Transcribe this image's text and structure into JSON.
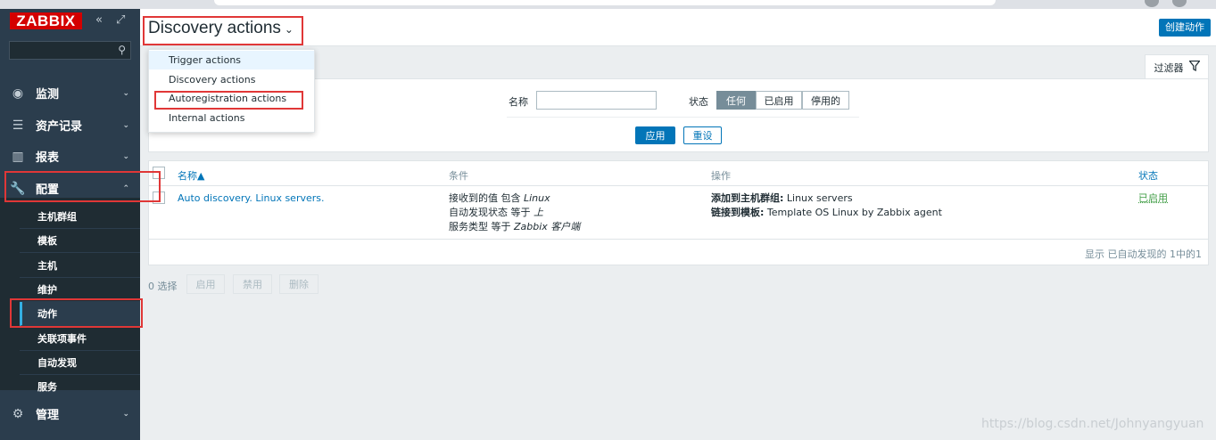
{
  "sidebar": {
    "logo": "ZABBIX",
    "collapse_icon": "double-chevron-left-icon",
    "kiosk_icon": "kiosk-icon",
    "search_icon": "search-icon",
    "nav": [
      {
        "label": "监测",
        "icon": "eye-icon"
      },
      {
        "label": "资产记录",
        "icon": "list-icon"
      },
      {
        "label": "报表",
        "icon": "bar-chart-icon"
      },
      {
        "label": "配置",
        "icon": "wrench-icon"
      },
      {
        "label": "管理",
        "icon": "gear-icon"
      }
    ],
    "submenu": [
      "主机群组",
      "模板",
      "主机",
      "维护",
      "动作",
      "关联项事件",
      "自动发现",
      "服务"
    ],
    "active_submenu": "动作"
  },
  "header": {
    "title": "Discovery actions",
    "create_button": "创建动作"
  },
  "dropdown": {
    "items": [
      "Trigger actions",
      "Discovery actions",
      "Autoregistration actions",
      "Internal actions"
    ],
    "hovered": "Trigger actions"
  },
  "filter": {
    "tab_label": "过滤器",
    "name_label": "名称",
    "name_value": "",
    "status_label": "状态",
    "status_options": [
      "任何",
      "已启用",
      "停用的"
    ],
    "status_selected": "任何",
    "apply": "应用",
    "reset": "重设"
  },
  "table": {
    "columns": {
      "name": "名称▲",
      "conditions": "条件",
      "operations": "操作",
      "status": "状态"
    },
    "rows": [
      {
        "name": "Auto discovery. Linux servers.",
        "conditions": [
          {
            "text": "接收到的值 包含 ",
            "value": "Linux"
          },
          {
            "text": "自动发现状态 等于 ",
            "value": "上"
          },
          {
            "text": "服务类型 等于 ",
            "value": "Zabbix 客户端"
          }
        ],
        "operations": [
          {
            "label": "添加到主机群组:",
            "value": " Linux servers"
          },
          {
            "label": "链接到模板:",
            "value": " Template OS Linux by Zabbix agent"
          }
        ],
        "status": "已启用"
      }
    ],
    "footer": "显示 已自动发现的 1中的1"
  },
  "mass_actions": {
    "selected": "0 选择",
    "buttons": [
      "启用",
      "禁用",
      "删除"
    ]
  },
  "watermark": "https://blog.csdn.net/Johnyangyuan",
  "colors": {
    "sidebar": "#2b3d4d",
    "accent": "#0275b8",
    "logo_red": "#d40000",
    "status_enabled": "#429e47",
    "annotation_red": "#e03737"
  }
}
